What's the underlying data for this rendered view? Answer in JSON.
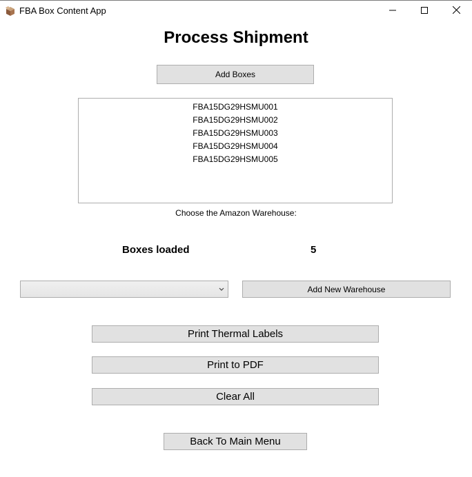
{
  "window": {
    "title": "FBA Box Content App",
    "controls": {
      "minimize": "minimize-icon",
      "maximize": "maximize-icon",
      "close": "close-icon"
    }
  },
  "page": {
    "title": "Process Shipment"
  },
  "buttons": {
    "add_boxes": "Add Boxes",
    "add_new_warehouse": "Add New Warehouse",
    "print_thermal_labels": "Print Thermal Labels",
    "print_to_pdf": "Print to PDF",
    "clear_all": "Clear All",
    "back_to_main_menu": "Back To Main Menu"
  },
  "box_list": {
    "items": [
      "FBA15DG29HSMU001",
      "FBA15DG29HSMU002",
      "FBA15DG29HSMU003",
      "FBA15DG29HSMU004",
      "FBA15DG29HSMU005"
    ]
  },
  "warehouse": {
    "prompt": "Choose the Amazon Warehouse:",
    "selected": ""
  },
  "boxes_loaded": {
    "label": "Boxes loaded",
    "count": "5"
  },
  "colors": {
    "button_bg": "#e1e1e1",
    "button_border": "#adadad"
  }
}
